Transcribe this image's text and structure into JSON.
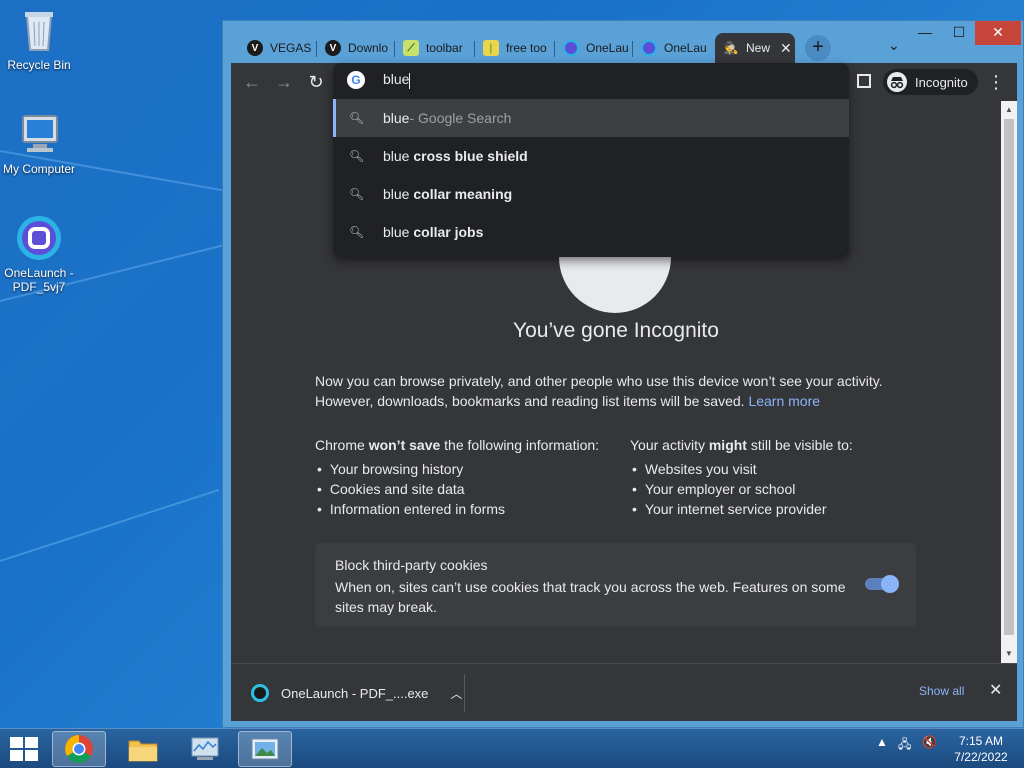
{
  "desktop": {
    "icons": [
      {
        "label": "Recycle Bin",
        "icon": "recycle-bin-icon"
      },
      {
        "label": "My Computer",
        "icon": "computer-icon"
      },
      {
        "label": "OneLaunch - PDF_5vj7",
        "icon": "onelaunch-icon"
      }
    ]
  },
  "browser": {
    "tabs": [
      {
        "label": "VEGAS",
        "icon": "vegas-icon"
      },
      {
        "label": "Downlo",
        "icon": "vegas-icon"
      },
      {
        "label": "toolbar",
        "icon": "toolbar-icon"
      },
      {
        "label": "free too",
        "icon": "leaf-icon"
      },
      {
        "label": "OneLau",
        "icon": "onelaunch-icon"
      },
      {
        "label": "OneLau",
        "icon": "onelaunch-icon"
      },
      {
        "label": "New",
        "icon": "incognito-icon",
        "active": true
      }
    ],
    "new_tab_glyph": "+",
    "incognito_label": "Incognito",
    "omnibox": {
      "text": "blue",
      "suggestions": [
        {
          "prefix": "blue",
          "rest": "",
          "suffix": " - Google Search",
          "highlighted": true
        },
        {
          "prefix": "blue ",
          "rest": "cross blue shield",
          "suffix": ""
        },
        {
          "prefix": "blue ",
          "rest": "collar meaning",
          "suffix": ""
        },
        {
          "prefix": "blue ",
          "rest": "collar jobs",
          "suffix": ""
        }
      ]
    },
    "page": {
      "title": "You’ve gone Incognito",
      "para_line1": "Now you can browse privately, and other people who use this device won’t see your activity.",
      "para_line2": "However, downloads, bookmarks and reading list items will be saved.",
      "learn_more": "Learn more",
      "left_col": {
        "heading_pre": "Chrome ",
        "heading_bold": "won’t save",
        "heading_post": " the following information:",
        "items": [
          "Your browsing history",
          "Cookies and site data",
          "Information entered in forms"
        ]
      },
      "right_col": {
        "heading_pre": "Your activity ",
        "heading_bold": "might",
        "heading_post": " still be visible to:",
        "items": [
          "Websites you visit",
          "Your employer or school",
          "Your internet service provider"
        ]
      },
      "cookies": {
        "title": "Block third-party cookies",
        "desc": "When on, sites can’t use cookies that track you across the web. Features on some sites may break.",
        "enabled": true
      }
    },
    "download_bar": {
      "file": "OneLaunch - PDF_....exe",
      "show_all": "Show all"
    }
  },
  "taskbar": {
    "time": "7:15 AM",
    "date": "7/22/2022"
  },
  "colors": {
    "desktop": "#1a73c9",
    "chrome_dark": "#35363a",
    "link": "#8ab4f8"
  }
}
